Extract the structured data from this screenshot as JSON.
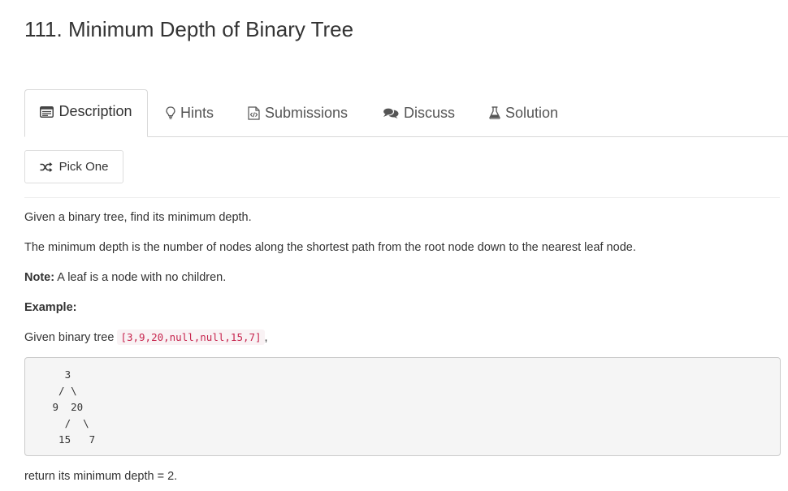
{
  "problem": {
    "title": "111. Minimum Depth of Binary Tree"
  },
  "tabs": [
    {
      "label": "Description",
      "icon": "description-icon",
      "active": true
    },
    {
      "label": "Hints",
      "icon": "lightbulb-icon",
      "active": false
    },
    {
      "label": "Submissions",
      "icon": "code-file-icon",
      "active": false
    },
    {
      "label": "Discuss",
      "icon": "comments-icon",
      "active": false
    },
    {
      "label": "Solution",
      "icon": "flask-icon",
      "active": false
    }
  ],
  "pick_one": {
    "label": "Pick One",
    "icon": "shuffle-icon"
  },
  "description": {
    "p1": "Given a binary tree, find its minimum depth.",
    "p2": "The minimum depth is the number of nodes along the shortest path from the root node down to the nearest leaf node.",
    "note_label": "Note:",
    "note_text": " A leaf is a node with no children.",
    "example_label": "Example:",
    "given_prefix": "Given binary tree ",
    "given_code": "[3,9,20,null,null,15,7]",
    "given_suffix": ",",
    "tree_diagram": "   3\n  / \\\n 9  20\n   /  \\\n  15   7",
    "return_text": "return its minimum depth = 2."
  },
  "colors": {
    "inline_code_text": "#c7254e",
    "inline_code_bg": "#f9f2f4",
    "code_block_bg": "#f5f5f5"
  }
}
